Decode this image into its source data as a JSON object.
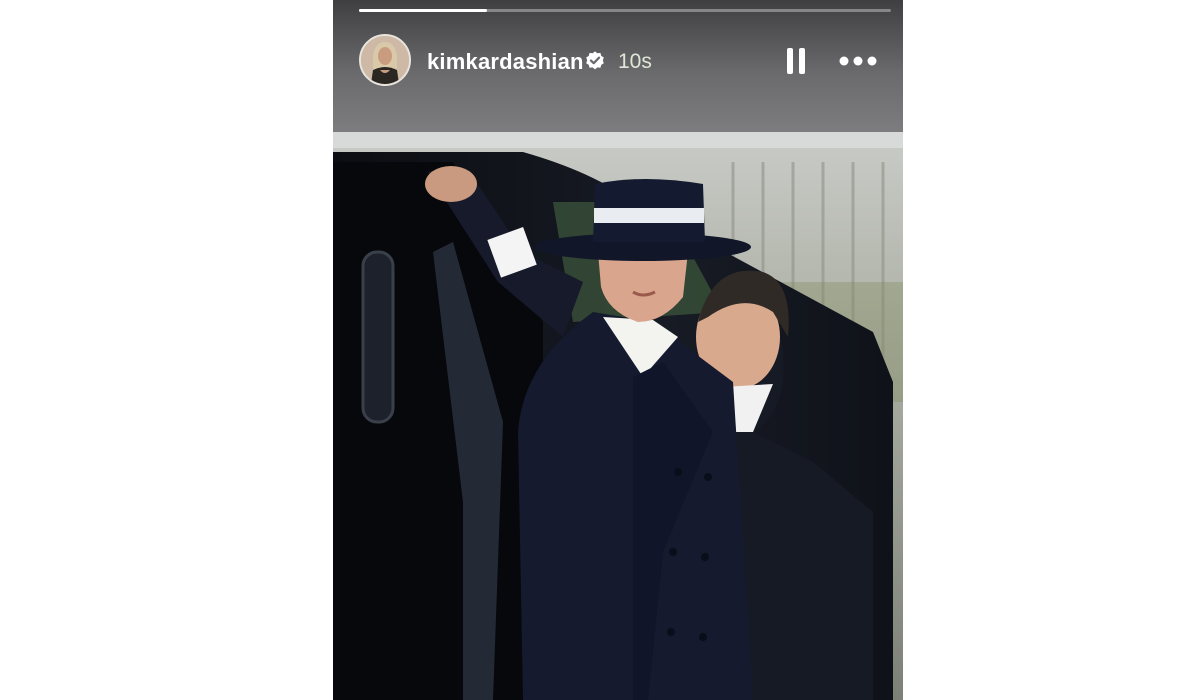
{
  "story": {
    "progress": 0.24,
    "username": "kimkardashian",
    "verified": true,
    "time": "10s",
    "avatar_icon": "profile-photo",
    "pause_icon": "pause-icon",
    "more_icon": "more-options-icon",
    "photo_description_icon": "story-photo"
  },
  "colors": {
    "header_dark": "#3f3f41",
    "header_light": "#7d7d7f",
    "coat": "#151a2e",
    "hat_band": "#e9ecf0",
    "car": "#0d1018"
  }
}
